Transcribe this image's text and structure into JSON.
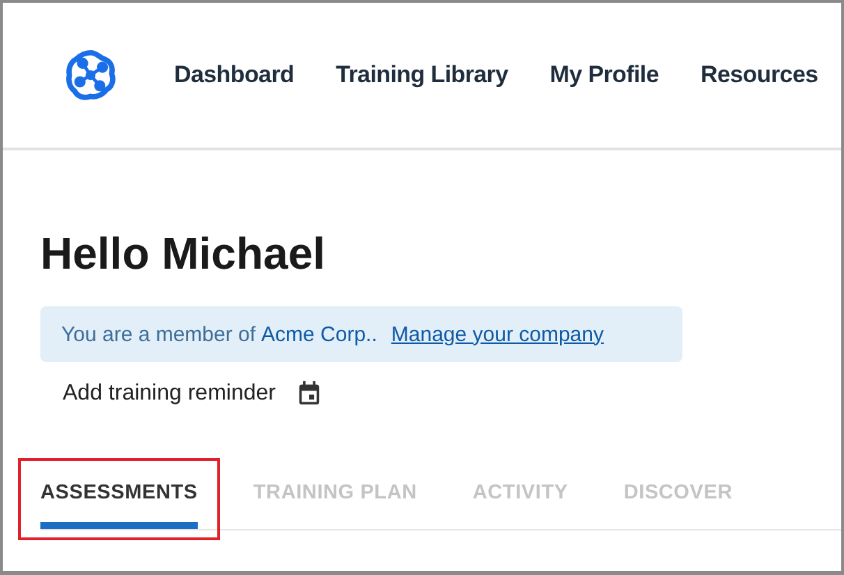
{
  "nav": {
    "items": [
      {
        "label": "Dashboard"
      },
      {
        "label": "Training Library"
      },
      {
        "label": "My Profile"
      },
      {
        "label": "Resources"
      }
    ]
  },
  "greeting": "Hello Michael",
  "membership": {
    "text": "You are a member of",
    "company": "Acme Corp..",
    "link": "Manage your company"
  },
  "reminder": {
    "label": "Add training reminder"
  },
  "tabs": [
    {
      "label": "ASSESSMENTS",
      "selected": true,
      "highlighted": true
    },
    {
      "label": "TRAINING PLAN",
      "selected": false,
      "highlighted": false
    },
    {
      "label": "ACTIVITY",
      "selected": false,
      "highlighted": false
    },
    {
      "label": "DISCOVER",
      "selected": false,
      "highlighted": false
    }
  ]
}
